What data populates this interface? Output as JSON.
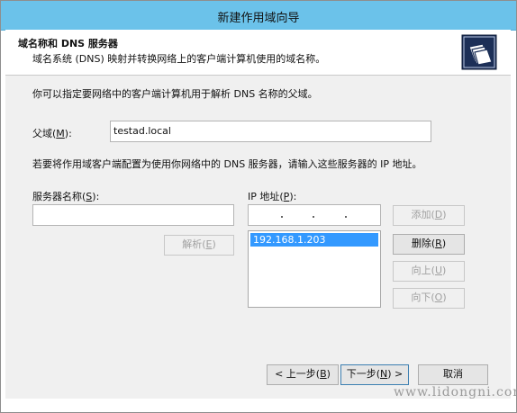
{
  "window": {
    "title": "新建作用域向导"
  },
  "header": {
    "title": "域名称和 DNS 服务器",
    "subtitle": "域名系统 (DNS) 映射并转换网络上的客户端计算机使用的域名称。",
    "icon": "wizard-folder-icon"
  },
  "intro": "你可以指定要网络中的客户端计算机用于解析 DNS 名称的父域。",
  "parent_domain": {
    "label": "父域(",
    "mnemonic": "M",
    "label_end": "):",
    "value": "testad.local"
  },
  "dns_instruction": "若要将作用域客户端配置为使用你网络中的 DNS 服务器，请输入这些服务器的 IP 地址。",
  "server_name": {
    "label": "服务器名称(",
    "mnemonic": "S",
    "label_end": "):",
    "value": ""
  },
  "ip_address": {
    "label": "IP 地址(",
    "mnemonic": "P",
    "label_end": "):"
  },
  "resolve_button": {
    "label": "解析(",
    "mnemonic": "E",
    "label_end": ")"
  },
  "ip_list": [
    "192.168.1.203"
  ],
  "buttons": {
    "add": {
      "label": "添加(",
      "mnemonic": "D",
      "label_end": ")"
    },
    "delete": {
      "label": "删除(",
      "mnemonic": "R",
      "label_end": ")"
    },
    "up": {
      "label": "向上(",
      "mnemonic": "U",
      "label_end": ")"
    },
    "down": {
      "label": "向下(",
      "mnemonic": "O",
      "label_end": ")"
    }
  },
  "footer": {
    "back": {
      "label": "< 上一步(",
      "mnemonic": "B",
      "label_end": ")"
    },
    "next": {
      "label": "下一步(",
      "mnemonic": "N",
      "label_end": ") >"
    },
    "cancel": "取消"
  },
  "watermark": "www.lidongni.com",
  "colors": {
    "titlebar": "#6bc2ea",
    "selection": "#3399ff",
    "dialog_bg": "#f0f0f0"
  }
}
